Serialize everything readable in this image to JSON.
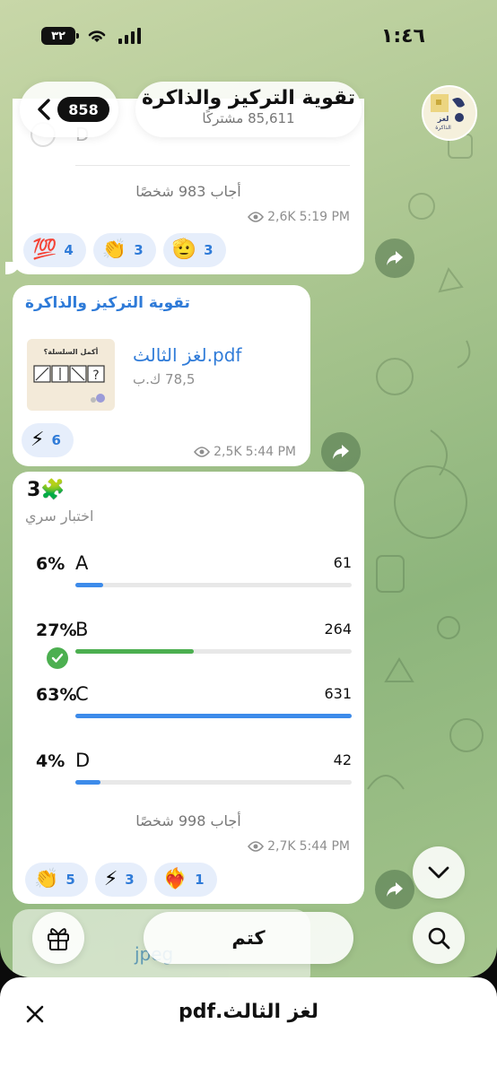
{
  "status_bar": {
    "time": "١:٤٦",
    "battery": "٣٢"
  },
  "header": {
    "back_badge": "858",
    "title": "تقوية التركيز والذاكرة",
    "subtitle": "85,611 مشتركًا"
  },
  "avatar_text": "لغز الذاكرة",
  "poll_top": {
    "partial_option": "D",
    "voters": "أجاب 983 شخصًا",
    "views": "2,6K",
    "time": "5:19 PM",
    "reactions": [
      {
        "emoji": "💯",
        "count": "4"
      },
      {
        "emoji": "👏",
        "count": "3"
      },
      {
        "emoji": "🫡",
        "count": "3"
      }
    ]
  },
  "file_message": {
    "author": "تقوية التركيز والذاكرة",
    "file_name": "لغز الثالث.pdf",
    "file_size": "78,5 ك.ب",
    "thumb_title": "أكمل السلسلة؟",
    "views": "2,5K",
    "time": "5:44 PM",
    "reactions": [
      {
        "emoji": "⚡",
        "count": "6"
      }
    ]
  },
  "poll": {
    "title": "3🧩",
    "type": "اختبار سري",
    "options": [
      {
        "pct": "6%",
        "letter": "A",
        "count": "61",
        "fraction": 0.1
      },
      {
        "pct": "27%",
        "letter": "B",
        "count": "264",
        "fraction": 0.43,
        "correct": true
      },
      {
        "pct": "63%",
        "letter": "C",
        "count": "631",
        "fraction": 1.0
      },
      {
        "pct": "4%",
        "letter": "D",
        "count": "42",
        "fraction": 0.09
      }
    ],
    "voters": "أجاب 998 شخصًا",
    "views": "2,7K",
    "time": "5:44 PM",
    "reactions": [
      {
        "emoji": "👏",
        "count": "5"
      },
      {
        "emoji": "⚡",
        "count": "3"
      },
      {
        "emoji": "❤️‍🔥",
        "count": "1"
      }
    ]
  },
  "next_preview": {
    "text": "jpeg"
  },
  "bottom": {
    "mute_label": "كتم"
  },
  "sheet": {
    "title": "لغز الثالث.pdf"
  },
  "colors": {
    "accent": "#2f7bd8",
    "correct": "#4caf50",
    "bar_blue": "#3d8bea"
  }
}
